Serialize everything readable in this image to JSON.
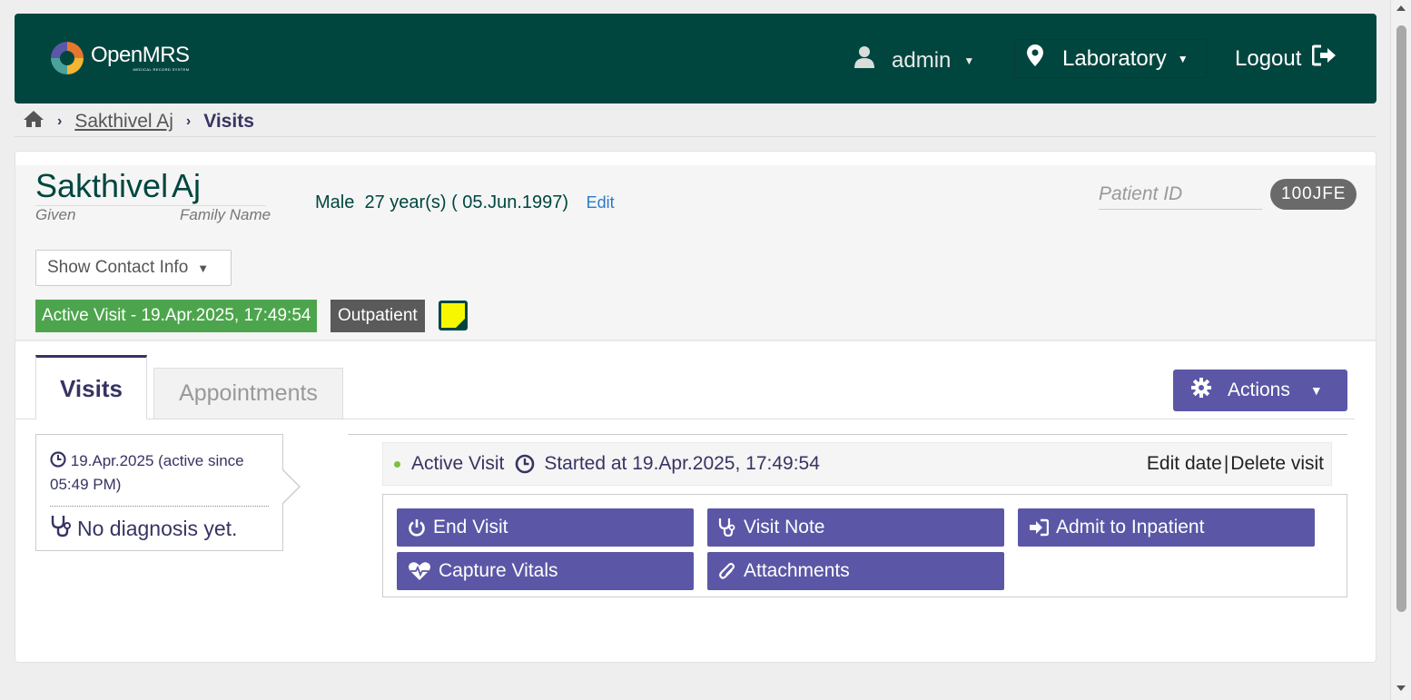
{
  "header": {
    "logo_text": "OpenMRS",
    "logo_subtext": "MEDICAL RECORD SYSTEM",
    "user": "admin",
    "location": "Laboratory",
    "logout": "Logout"
  },
  "breadcrumb": {
    "patient": "Sakthivel Aj",
    "current": "Visits"
  },
  "patient": {
    "given_name": "Sakthivel",
    "family_name": "Aj",
    "given_label": "Given",
    "family_label": "Family Name",
    "gender": "Male",
    "age_dob": "27 year(s) ( 05.Jun.1997)",
    "edit": "Edit",
    "id_label": "Patient ID",
    "id_value": "100JFE",
    "contact_button": "Show Contact Info",
    "active_visit_badge": "Active Visit - 19.Apr.2025, 17:49:54",
    "visit_type_badge": "Outpatient"
  },
  "tabs": {
    "visits": "Visits",
    "appointments": "Appointments",
    "actions": "Actions"
  },
  "visit_list": {
    "date": "19.Apr.2025 (active since 05:49 PM)",
    "diagnosis": "No diagnosis yet."
  },
  "active_visit": {
    "title": "Active Visit",
    "started": "Started at 19.Apr.2025, 17:49:54",
    "edit_date": "Edit date",
    "separator": "|",
    "delete_visit": "Delete visit",
    "buttons": {
      "end_visit": "End Visit",
      "visit_note": "Visit Note",
      "admit": "Admit to Inpatient",
      "capture_vitals": "Capture Vitals",
      "attachments": "Attachments"
    }
  },
  "colors": {
    "header_bg": "#00463f",
    "primary_button": "#5b57a6",
    "active_badge": "#4ca54c"
  }
}
